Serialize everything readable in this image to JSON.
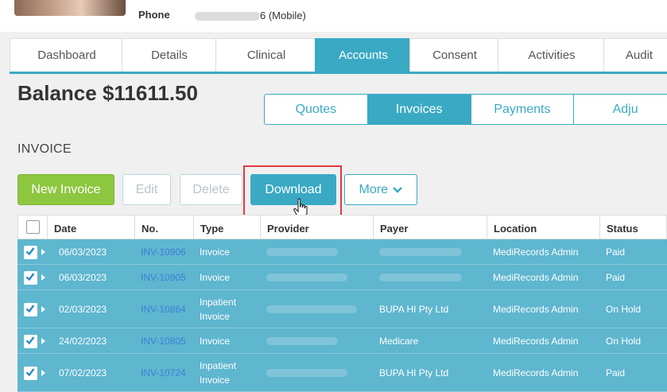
{
  "patient": {
    "phone_label": "Phone",
    "phone_suffix": "6 (Mobile)"
  },
  "tabs": [
    {
      "label": "Dashboard",
      "active": false
    },
    {
      "label": "Details",
      "active": false
    },
    {
      "label": "Clinical",
      "active": false
    },
    {
      "label": "Accounts",
      "active": true
    },
    {
      "label": "Consent",
      "active": false
    },
    {
      "label": "Activities",
      "active": false
    },
    {
      "label": "Audit",
      "active": false
    }
  ],
  "balance": "Balance $11611.50",
  "subtabs": [
    {
      "label": "Quotes",
      "active": false
    },
    {
      "label": "Invoices",
      "active": true
    },
    {
      "label": "Payments",
      "active": false
    },
    {
      "label": "Adju",
      "active": false
    }
  ],
  "section_title": "INVOICE",
  "toolbar": {
    "new_label": "New Invoice",
    "edit_label": "Edit",
    "delete_label": "Delete",
    "download_label": "Download",
    "more_label": "More"
  },
  "table": {
    "headers": [
      "Date",
      "No.",
      "Type",
      "Provider",
      "Payer",
      "Location",
      "Status"
    ],
    "rows": [
      {
        "checked": true,
        "date": "06/03/2023",
        "no": "INV-10906",
        "type": "Invoice",
        "payer": "",
        "location": "MediRecords Admin",
        "status": "Paid"
      },
      {
        "checked": true,
        "date": "06/03/2023",
        "no": "INV-10905",
        "type": "Invoice",
        "payer": "",
        "location": "MediRecords Admin",
        "status": "Paid"
      },
      {
        "checked": true,
        "date": "02/03/2023",
        "no": "INV-10864",
        "type": "Inpatient Invoice",
        "payer": "BUPA HI Pty Ltd",
        "location": "MediRecords Admin",
        "status": "On Hold"
      },
      {
        "checked": true,
        "date": "24/02/2023",
        "no": "INV-10805",
        "type": "Invoice",
        "payer": "Medicare",
        "location": "MediRecords Admin",
        "status": "On Hold"
      },
      {
        "checked": true,
        "date": "07/02/2023",
        "no": "INV-10724",
        "type": "Inpatient Invoice",
        "payer": "BUPA HI Pty Ltd",
        "location": "MediRecords Admin",
        "status": "Paid"
      }
    ]
  },
  "colors": {
    "accent": "#3aa9c4",
    "row_selected": "#5eb6cf",
    "new_button": "#8dc63f",
    "highlight_box": "#e0393e",
    "invoice_link": "#3f7fd6"
  },
  "icons": [
    "chevron-down-icon",
    "hand-cursor-icon",
    "check-icon",
    "expand-arrow-icon"
  ]
}
